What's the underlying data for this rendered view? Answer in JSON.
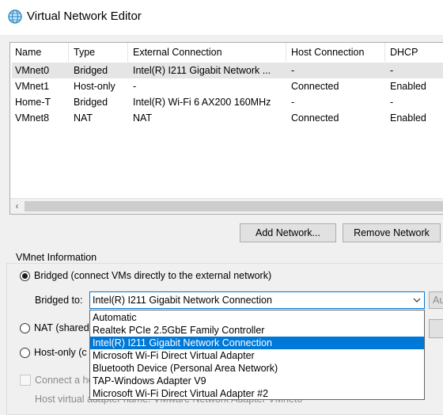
{
  "window": {
    "title": "Virtual Network Editor",
    "icon": "globe-icon"
  },
  "table": {
    "columns": [
      "Name",
      "Type",
      "External Connection",
      "Host Connection",
      "DHCP"
    ],
    "rows": [
      {
        "name": "VMnet0",
        "type": "Bridged",
        "external": "Intel(R) I211 Gigabit Network ...",
        "host": "-",
        "dhcp": "-"
      },
      {
        "name": "VMnet1",
        "type": "Host-only",
        "external": "-",
        "host": "Connected",
        "dhcp": "Enabled"
      },
      {
        "name": "Home-T",
        "type": "Bridged",
        "external": "Intel(R) Wi-Fi 6 AX200 160MHz",
        "host": "-",
        "dhcp": "-"
      },
      {
        "name": "VMnet8",
        "type": "NAT",
        "external": "NAT",
        "host": "Connected",
        "dhcp": "Enabled"
      }
    ],
    "selected_row": 0
  },
  "buttons": {
    "add_network": "Add Network...",
    "remove_network": "Remove Network",
    "auto_settings_partial": "Au"
  },
  "vmnet_info": {
    "group_label": "VMnet Information",
    "bridged_label": "Bridged (connect VMs directly to the external network)",
    "bridged_to_label": "Bridged to:",
    "bridged_to_value": "Intel(R) I211 Gigabit Network Connection",
    "nat_label_partial": "NAT (shared",
    "hostonly_label_partial": "Host-only (c",
    "connect_host_partial": "Connect a ho",
    "host_adapter_partial": "Host virtual adapter name: VMware Network Adapter VMnet0",
    "selected_mode": "bridged"
  },
  "dropdown": {
    "options": [
      "Automatic",
      "Realtek PCIe 2.5GbE Family Controller",
      "Intel(R) I211 Gigabit Network Connection",
      "Microsoft Wi-Fi Direct Virtual Adapter",
      "Bluetooth Device (Personal Area Network)",
      "TAP-Windows Adapter V9",
      "Microsoft Wi-Fi Direct Virtual Adapter #2"
    ],
    "selected_index": 2
  },
  "colors": {
    "accent": "#0078d7",
    "selected_row": "#e5e5e5"
  }
}
